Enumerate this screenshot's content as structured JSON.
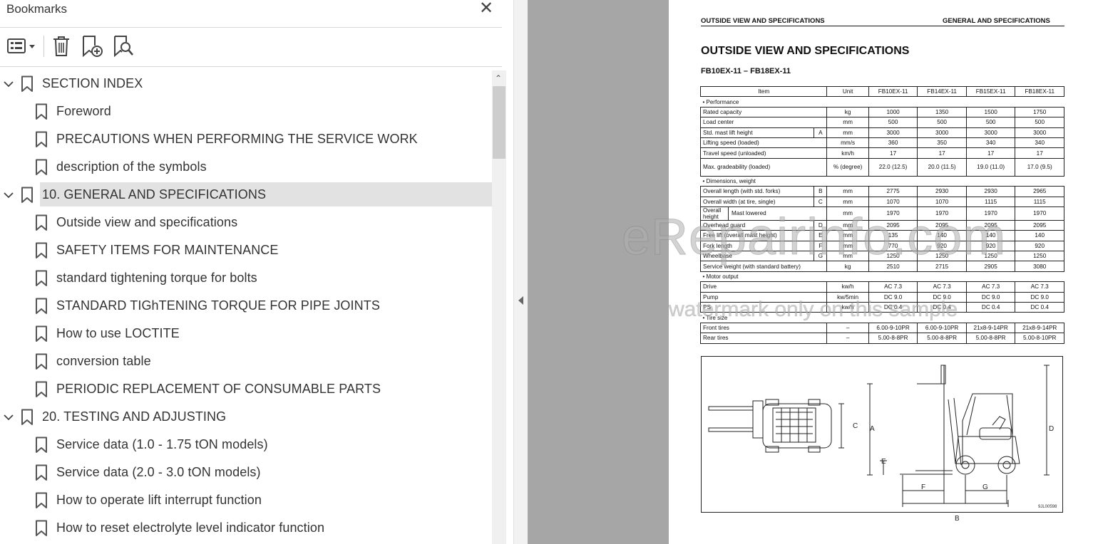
{
  "bookmarks_panel": {
    "title": "Bookmarks",
    "close_glyph": "✕",
    "toolbar": [
      {
        "icon": "options-list-icon"
      },
      {
        "icon": "delete-icon"
      },
      {
        "icon": "new-bookmark-icon"
      },
      {
        "icon": "find-bookmark-icon"
      }
    ],
    "items": [
      {
        "label": "SECTION INDEX",
        "level": 0,
        "expanded": true
      },
      {
        "label": "Foreword",
        "level": 1
      },
      {
        "label": "PRECAUTIONS WHEN PERFORMING THE SERVICE WORK",
        "level": 1
      },
      {
        "label": "description of the symbols",
        "level": 1
      },
      {
        "label": "10. GENERAL AND SPECIFICATIONS",
        "level": 0,
        "expanded": true,
        "selected": true
      },
      {
        "label": "Outside view and specifications",
        "level": 1
      },
      {
        "label": "SAFETY ITEMS FOR MAINTENANCE",
        "level": 1
      },
      {
        "label": "standard tightening torque for bolts",
        "level": 1
      },
      {
        "label": "STANDARD TIGhTENING TORQUE FOR PIPE JOINTS",
        "level": 1
      },
      {
        "label": "How to use LOCTITE",
        "level": 1
      },
      {
        "label": "conversion table",
        "level": 1
      },
      {
        "label": "PERIODIC REPLACEMENT OF CONSUMABLE PARTS",
        "level": 1
      },
      {
        "label": "20. TESTING AND ADJUSTING",
        "level": 0,
        "expanded": true
      },
      {
        "label": "Service data (1.0 - 1.75 tON models)",
        "level": 1
      },
      {
        "label": "Service data (2.0 - 3.0 tON models)",
        "level": 1
      },
      {
        "label": "How to operate lift interrupt function",
        "level": 1
      },
      {
        "label": "How to reset electrolyte level indicator function",
        "level": 1
      }
    ]
  },
  "document": {
    "header_left": "OUTSIDE VIEW AND SPECIFICATIONS",
    "header_right": "GENERAL AND SPECIFICATIONS",
    "title": "OUTSIDE VIEW AND SPECIFICATIONS",
    "subtitle": "FB10EX-11 – FB18EX-11",
    "table": {
      "headers": [
        "Item",
        "Unit",
        "FB10EX-11",
        "FB14EX-11",
        "FB15EX-11",
        "FB18EX-11"
      ],
      "rows": [
        {
          "section": "• Performance"
        },
        {
          "item": "Rated capacity",
          "unit": "kg",
          "v": [
            "1000",
            "1350",
            "1500",
            "1750"
          ]
        },
        {
          "item": "Load center",
          "unit": "mm",
          "v": [
            "500",
            "500",
            "500",
            "500"
          ]
        },
        {
          "item": "Std. mast lift height",
          "code": "A",
          "unit": "mm",
          "v": [
            "3000",
            "3000",
            "3000",
            "3000"
          ]
        },
        {
          "item": "Lifting speed (loaded)",
          "unit": "mm/s",
          "v": [
            "360",
            "350",
            "340",
            "340"
          ]
        },
        {
          "item": "Travel speed (unloaded)",
          "unit": "km/h",
          "v": [
            "17",
            "17",
            "17",
            "17"
          ]
        },
        {
          "item": "Max. gradeability (loaded)",
          "unit": "% (degree)",
          "v": [
            "22.0 (12.5)",
            "20.0 (11.5)",
            "19.0 (11.0)",
            "17.0 (9.5)"
          ],
          "tall": true
        },
        {
          "section": "• Dimensions, weight"
        },
        {
          "item": "Overall length (with std. forks)",
          "code": "B",
          "unit": "mm",
          "v": [
            "2775",
            "2930",
            "2930",
            "2965"
          ]
        },
        {
          "item": "Overall width (at tire,  single)",
          "code": "C",
          "unit": "mm",
          "v": [
            "1070",
            "1070",
            "1115",
            "1115"
          ]
        },
        {
          "item": "Mast lowered",
          "group": "Overall height",
          "unit": "mm",
          "v": [
            "1970",
            "1970",
            "1970",
            "1970"
          ]
        },
        {
          "item": "Overhead guard",
          "code": "D",
          "unit": "mm",
          "v": [
            "2095",
            "2095",
            "2095",
            "2095"
          ]
        },
        {
          "item": "Free lift (overall mast height)",
          "code": "E",
          "unit": "mm",
          "v": [
            "135",
            "140",
            "140",
            "140"
          ]
        },
        {
          "item": "Fork length",
          "code": "F",
          "unit": "mm",
          "v": [
            "770",
            "920",
            "920",
            "920"
          ]
        },
        {
          "item": "Wheelbase",
          "code": "G",
          "unit": "mm",
          "v": [
            "1250",
            "1250",
            "1250",
            "1250"
          ]
        },
        {
          "item": "Service weight (with standard battery)",
          "unit": "kg",
          "v": [
            "2510",
            "2715",
            "2905",
            "3080"
          ]
        },
        {
          "section": "• Motor output"
        },
        {
          "item": "Drive",
          "unit": "kw/h",
          "v": [
            "AC 7.3",
            "AC 7.3",
            "AC 7.3",
            "AC 7.3"
          ]
        },
        {
          "item": "Pump",
          "unit": "kw/5min",
          "v": [
            "DC 9.0",
            "DC 9.0",
            "DC 9.0",
            "DC 9.0"
          ]
        },
        {
          "item": "PS",
          "unit": "kw/h",
          "v": [
            "DC 0.4",
            "DC 0.4",
            "DC 0.4",
            "DC 0.4"
          ]
        },
        {
          "section": "• Tire size"
        },
        {
          "item": "Front tires",
          "unit": "–",
          "v": [
            "6.00-9-10PR",
            "6.00-9-10PR",
            "21x8-9-14PR",
            "21x8-9-14PR"
          ]
        },
        {
          "item": "Rear tires",
          "unit": "–",
          "v": [
            "5.00-8-8PR",
            "5.00-8-8PR",
            "5.00-8-8PR",
            "5.00-8-10PR"
          ]
        }
      ]
    },
    "drawing": {
      "dimension_labels": [
        "A",
        "B",
        "C",
        "D",
        "E",
        "F",
        "G"
      ],
      "figure_code": "9JL00598"
    },
    "watermark_main": "eRepairinfo.com",
    "watermark_sub": "watermark only on this sample"
  }
}
